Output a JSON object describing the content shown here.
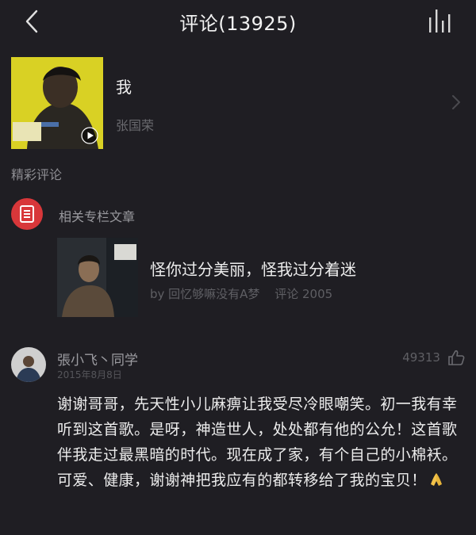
{
  "header": {
    "title": "评论(13925)",
    "back_icon": "chevron-left-icon",
    "playing_icon": "equalizer-bars-icon"
  },
  "song": {
    "name": "我",
    "artist": "张国荣",
    "cover_icon": "album-cover-image",
    "play_icon": "play-circle-icon"
  },
  "sections": {
    "hot_comments_label": "精彩评论",
    "column_label": "相关专栏文章"
  },
  "article": {
    "title": "怪你过分美丽，怪我过分着迷",
    "author": "by 回忆够嘛没有A梦",
    "comments": "评论 2005"
  },
  "comment": {
    "username": "張小飞丶同学",
    "date": "2015年8月8日",
    "likes": "49313",
    "text": "谢谢哥哥，先天性小儿麻痹让我受尽冷眼嘲笑。初一我有幸听到这首歌。是呀，神造世人，处处都有他的公允！这首歌伴我走过最黑暗的时代。现在成了家，有个自己的小棉袄。可爱、健康，谢谢神把我应有的都转移给了我的宝贝！",
    "emoji": "folded-hands-emoji"
  },
  "colors": {
    "background": "#1f1e23",
    "accent_red": "#d8373a",
    "album_yellow": "#d9d124"
  }
}
